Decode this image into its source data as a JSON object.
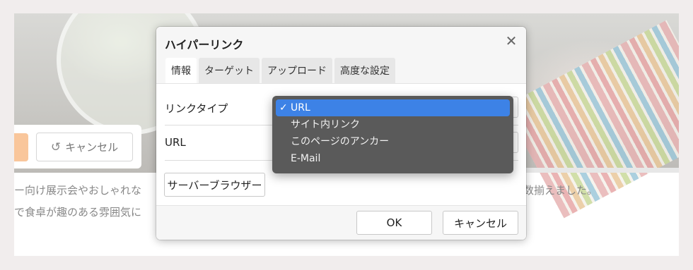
{
  "background": {
    "cancel_label": "キャンセル",
    "text_line1": "ー向け展示会やおしゃれな",
    "text_line2": "で食卓が趣のある雰囲気に",
    "text_right": "数揃えました。"
  },
  "dialog": {
    "title": "ハイパーリンク",
    "tabs": [
      "情報",
      "ターゲット",
      "アップロード",
      "高度な設定"
    ],
    "active_tab": 0,
    "link_type_label": "リンクタイプ",
    "url_label": "URL",
    "server_browser_label": "サーバーブラウザー",
    "ok_label": "OK",
    "cancel_label": "キャンセル"
  },
  "dropdown": {
    "options": [
      "URL",
      "サイト内リンク",
      "このページのアンカー",
      "E-Mail"
    ],
    "selected_index": 0
  },
  "icons": {
    "close": "close-icon",
    "undo": "undo-icon",
    "check": "checkmark-icon"
  },
  "colors": {
    "selected_option": "#3d82e6",
    "dropdown_bg": "#5a5a5a",
    "orange_button": "#f9c69b"
  }
}
